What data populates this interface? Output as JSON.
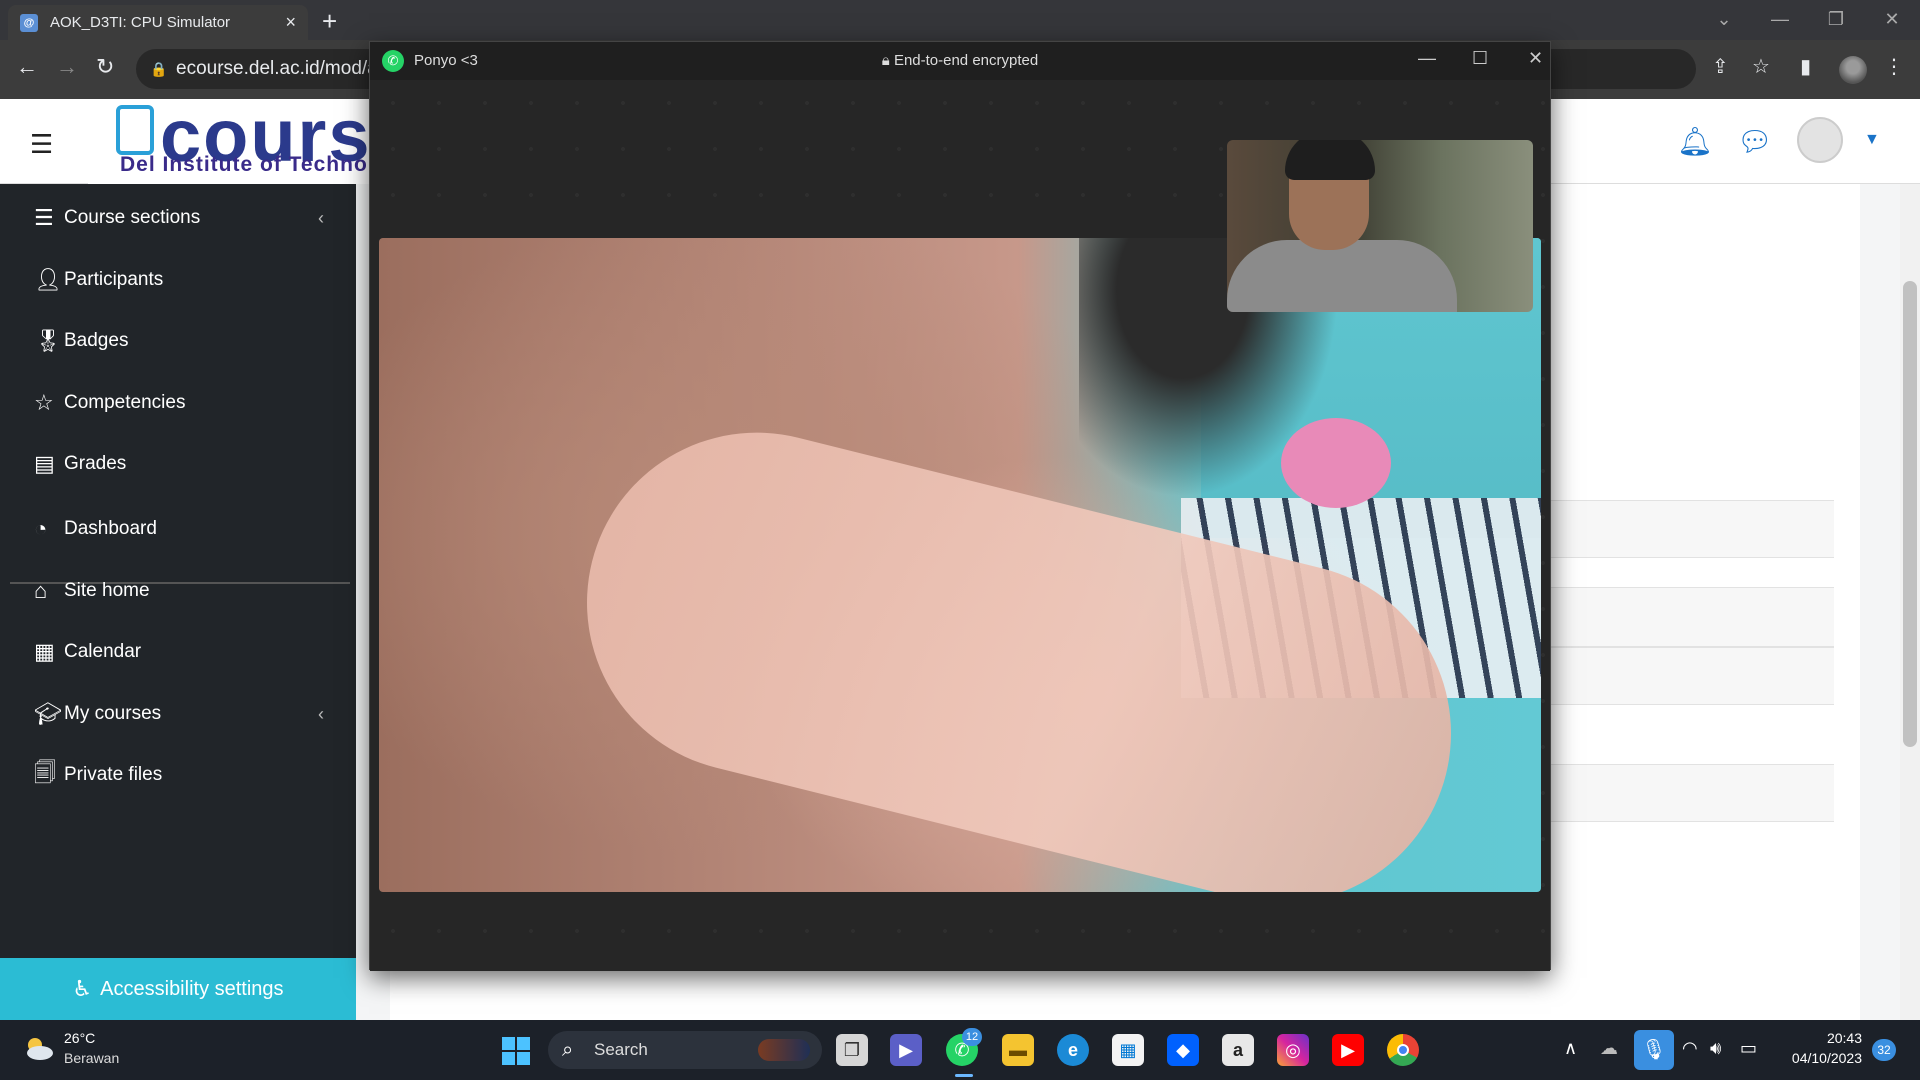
{
  "browser": {
    "tab_title": "AOK_D3TI: CPU Simulator",
    "tab_favicon_letter": "@",
    "url": "ecourse.del.ac.id/mod/as",
    "icons": [
      "back-icon",
      "forward-icon",
      "reload-icon",
      "lock-icon",
      "share-icon",
      "star-icon",
      "sidepanel-icon",
      "profile-icon",
      "menu-icon"
    ]
  },
  "site": {
    "logo_main": "cours",
    "logo_sub": "Del Institute of Technol",
    "nav": [
      {
        "label": "Course sections",
        "icon": "list-icon",
        "chevron": "‹"
      },
      {
        "label": "Participants",
        "icon": "participants-icon"
      },
      {
        "label": "Badges",
        "icon": "badge-icon"
      },
      {
        "label": "Competencies",
        "icon": "star-outline-icon"
      },
      {
        "label": "Grades",
        "icon": "grades-icon"
      },
      {
        "label": "Dashboard",
        "icon": "dashboard-icon"
      },
      {
        "label": "Site home",
        "icon": "home-icon"
      },
      {
        "label": "Calendar",
        "icon": "calendar-icon"
      },
      {
        "label": "My courses",
        "icon": "graduation-cap-icon",
        "chevron": "‹"
      },
      {
        "label": "Private files",
        "icon": "files-icon"
      }
    ],
    "accessibility_label": "Accessibility settings"
  },
  "call": {
    "contact_name": "Ponyo <3",
    "encryption_text": "End-to-end encrypted"
  },
  "taskbar": {
    "weather_temp": "26°C",
    "weather_desc": "Berawan",
    "search_label": "Search",
    "whatsapp_badge": "12",
    "time": "20:43",
    "date": "04/10/2023",
    "notification_count": "32",
    "accent": "#4cc2ff"
  }
}
